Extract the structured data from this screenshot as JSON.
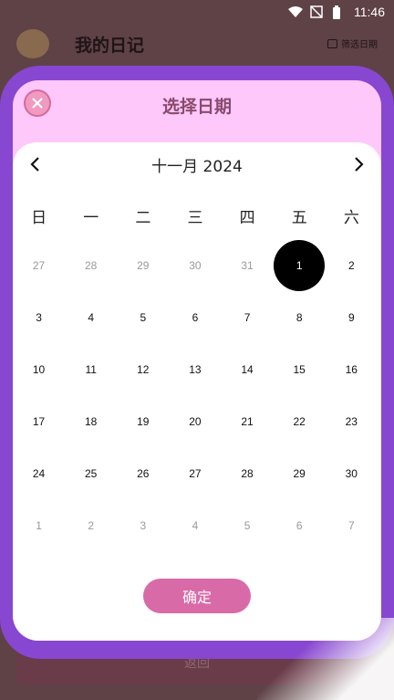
{
  "status": {
    "time": "11:46"
  },
  "app": {
    "title": "我的日记",
    "filter_label": "筛选日期",
    "back_label": "返回"
  },
  "dialog": {
    "title": "选择日期",
    "month_label": "十一月 2024",
    "confirm_label": "确定"
  },
  "weekdays": [
    "日",
    "一",
    "二",
    "三",
    "四",
    "五",
    "六"
  ],
  "weeks": [
    [
      "27",
      "28",
      "29",
      "30",
      "31",
      "1",
      "2"
    ],
    [
      "3",
      "4",
      "5",
      "6",
      "7",
      "8",
      "9"
    ],
    [
      "10",
      "11",
      "12",
      "13",
      "14",
      "15",
      "16"
    ],
    [
      "17",
      "18",
      "19",
      "20",
      "21",
      "22",
      "23"
    ],
    [
      "24",
      "25",
      "26",
      "27",
      "28",
      "29",
      "30"
    ],
    [
      "1",
      "2",
      "3",
      "4",
      "5",
      "6",
      "7"
    ]
  ],
  "selected_day": "1",
  "colors": {
    "frame": "#8847d0",
    "dialog_bg": "#ffc8fb",
    "confirm": "#d96aa8",
    "title": "#8a4a6c"
  }
}
